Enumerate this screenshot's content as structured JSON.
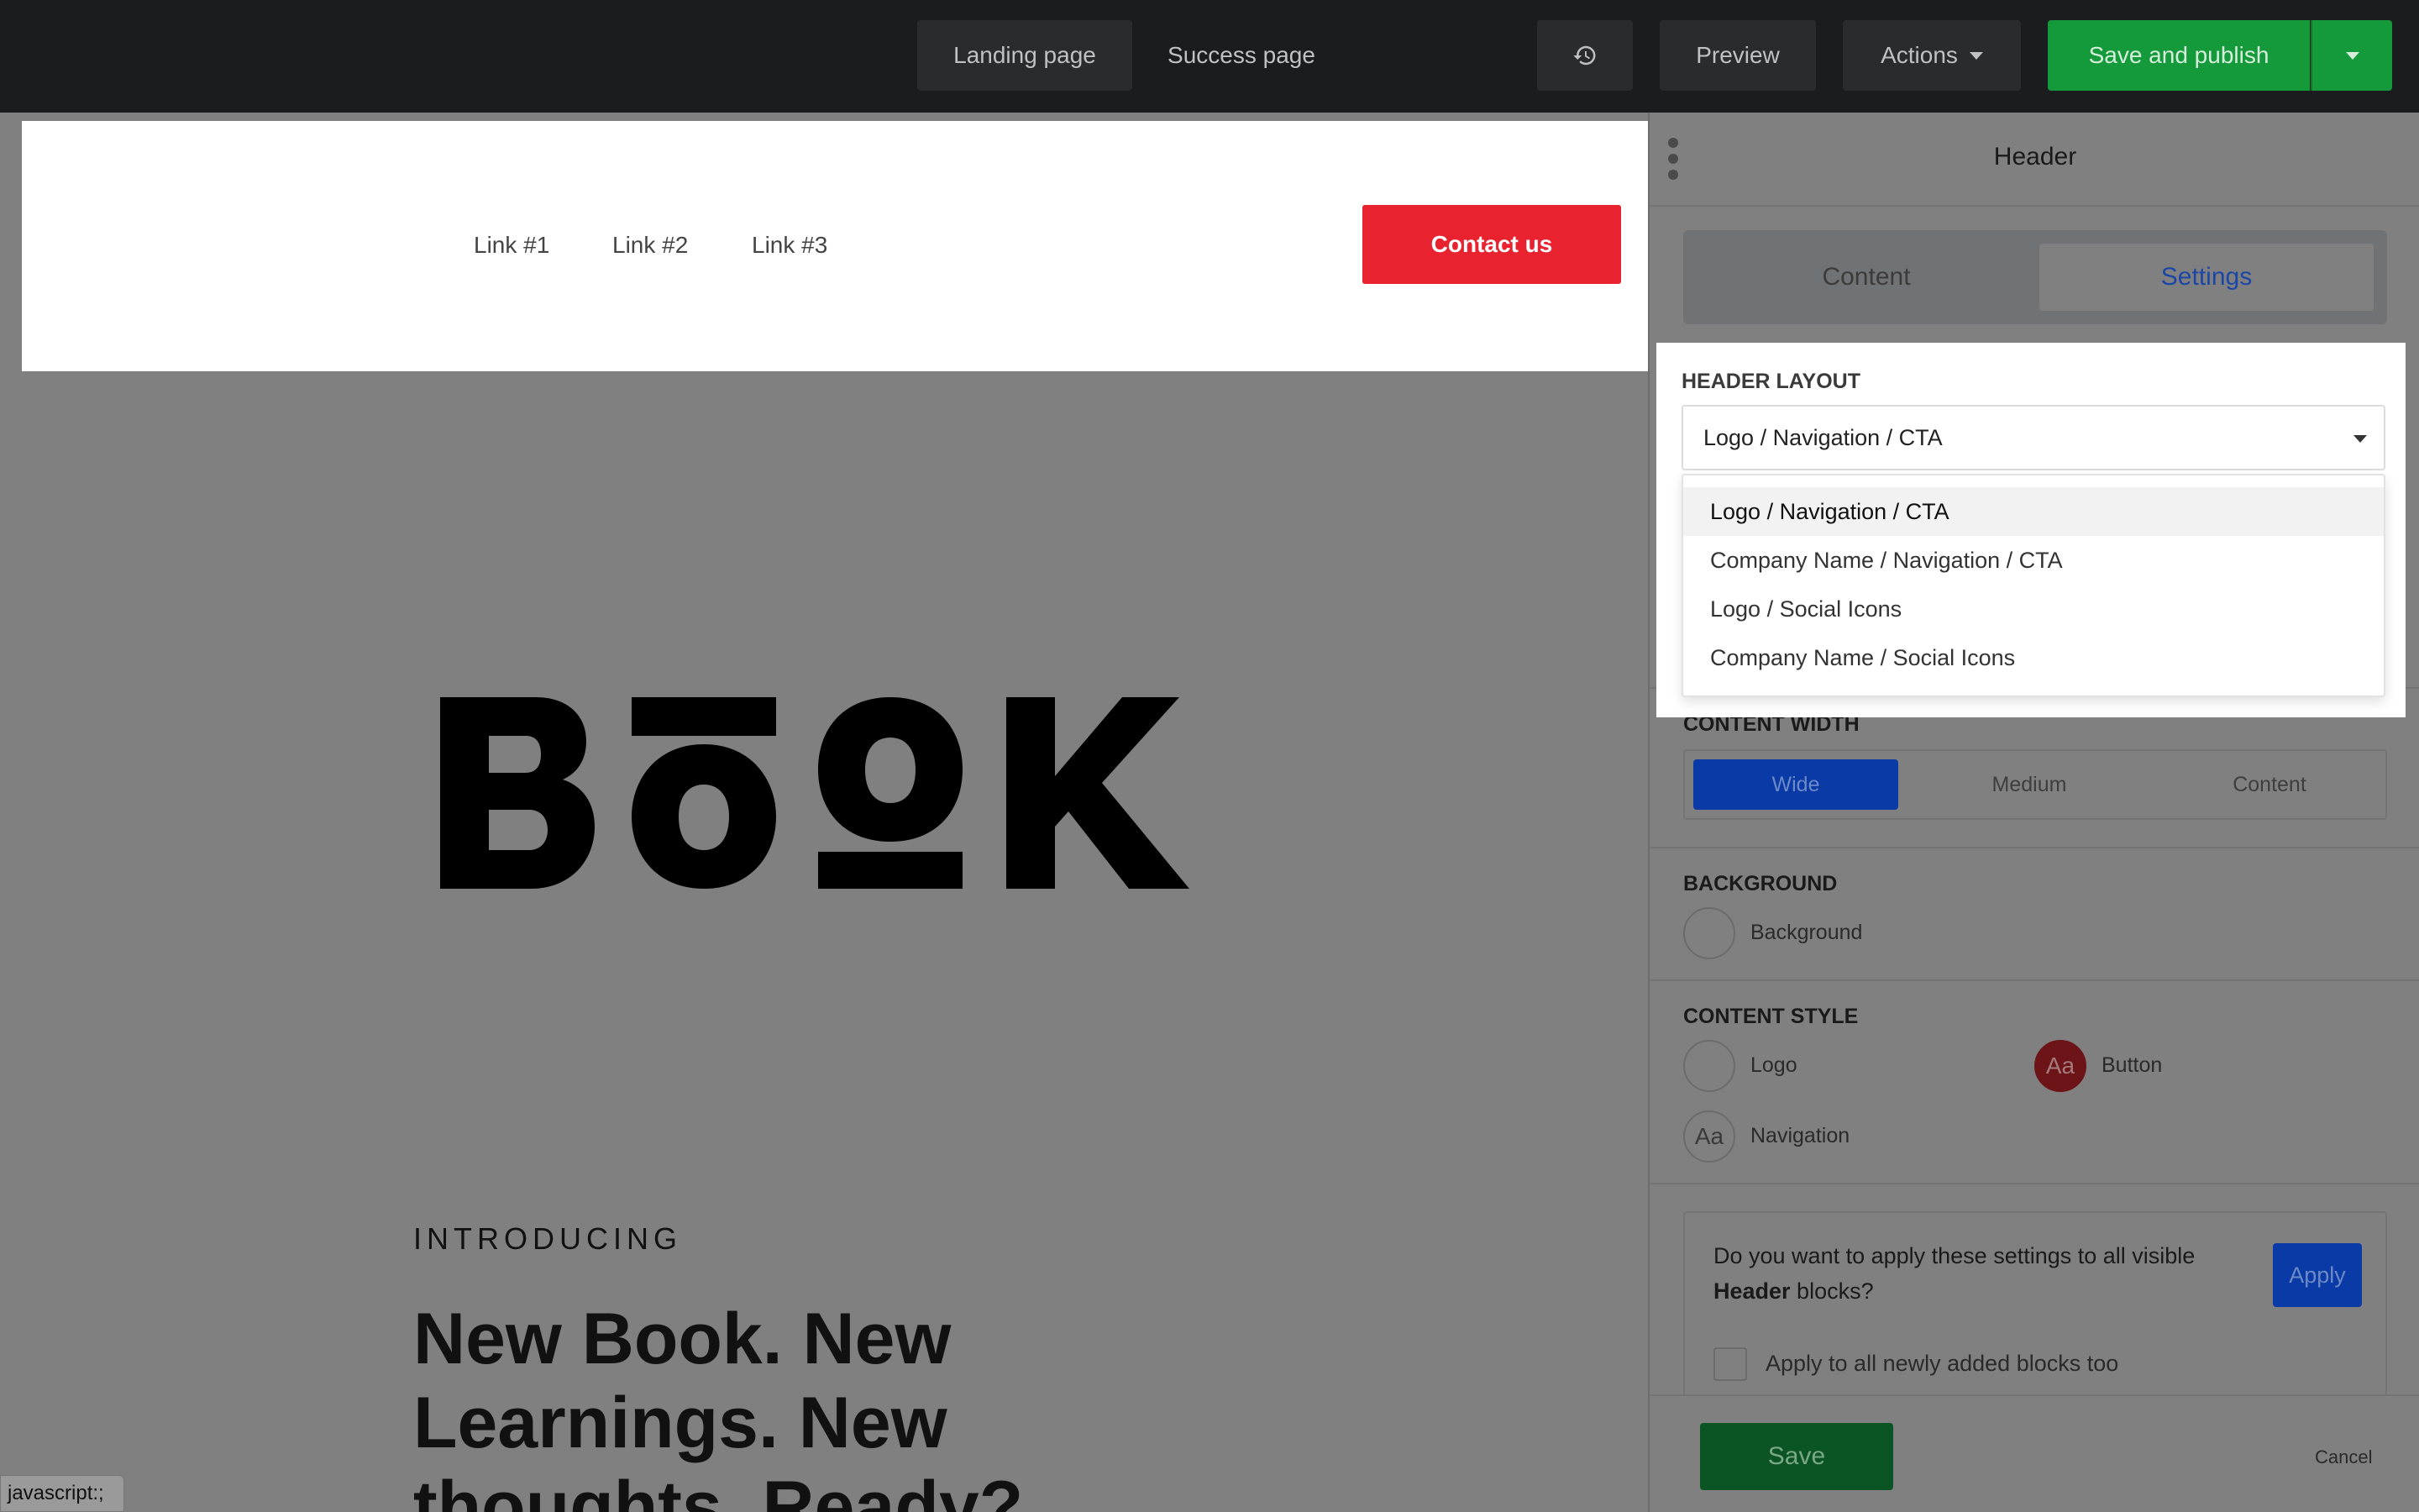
{
  "topbar": {
    "tab_landing": "Landing page",
    "tab_success": "Success page",
    "history_icon": "history-icon",
    "preview_label": "Preview",
    "actions_label": "Actions",
    "save_publish_label": "Save and publish"
  },
  "site_header": {
    "nav_links": [
      "Link #1",
      "Link #2",
      "Link #3"
    ],
    "cta_label": "Contact us",
    "cta_color": "#e8222f"
  },
  "hero": {
    "logo_text": "BOOK",
    "intro": "INTRODUCING",
    "headline": "New Book. New Learnings. New thoughts. Ready?"
  },
  "status_bar": {
    "text": "javascript:;"
  },
  "panel": {
    "title": "Header",
    "tabs": [
      "Content",
      "Settings"
    ],
    "active_tab": "Settings",
    "header_layout": {
      "label": "HEADER LAYOUT",
      "selected": "Logo / Navigation / CTA",
      "options": [
        "Logo / Navigation / CTA",
        "Company Name / Navigation / CTA",
        "Logo / Social Icons",
        "Company Name / Social Icons"
      ]
    },
    "content_width": {
      "label": "CONTENT WIDTH",
      "options": [
        "Wide",
        "Medium",
        "Content"
      ],
      "selected": "Wide"
    },
    "background": {
      "label": "BACKGROUND",
      "item": "Background"
    },
    "content_style": {
      "label": "CONTENT STYLE",
      "logo": "Logo",
      "button": "Button",
      "button_swatch_text": "Aa",
      "navigation": "Navigation",
      "navigation_swatch_text": "Aa"
    },
    "apply": {
      "question_pre": "Do you want to apply these settings to all visible ",
      "question_bold": "Header",
      "question_post": " blocks?",
      "apply_label": "Apply",
      "checkbox_label": "Apply to all newly added blocks too",
      "checked": false
    },
    "footer": {
      "save_label": "Save",
      "cancel_label": "Cancel"
    }
  },
  "colors": {
    "accent_blue": "#0a3aa5",
    "publish_green": "#159a3b",
    "topbar_bg": "#1b1c1e"
  }
}
